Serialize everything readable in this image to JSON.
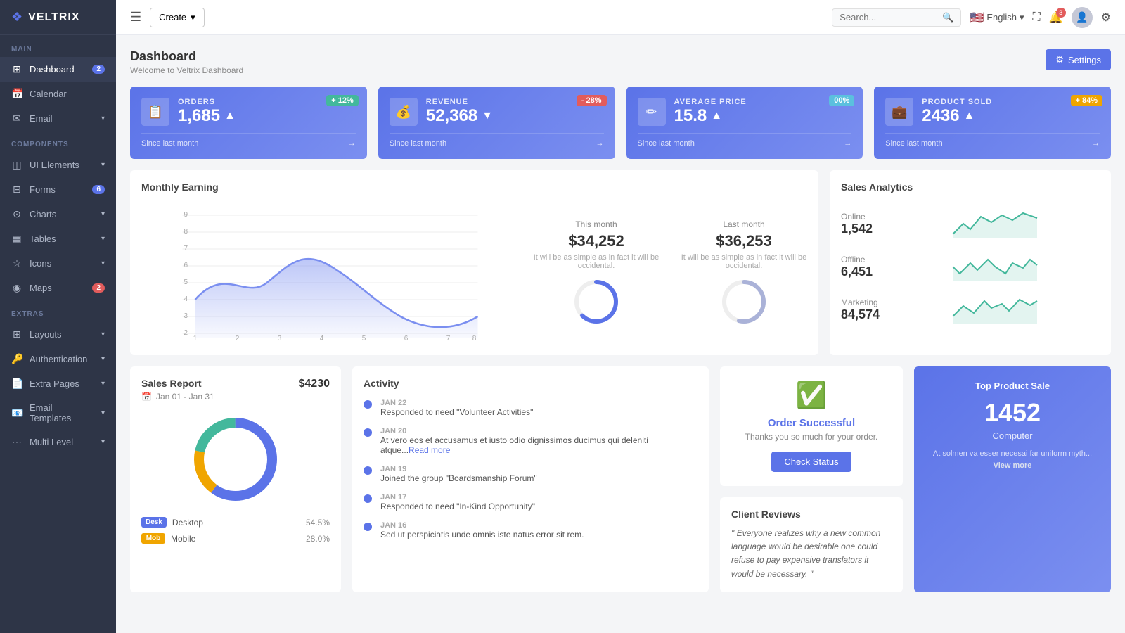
{
  "sidebar": {
    "logo": "VELTRIX",
    "sections": [
      {
        "label": "MAIN",
        "items": [
          {
            "id": "dashboard",
            "label": "Dashboard",
            "icon": "⊞",
            "badge": "2",
            "badgeColor": "blue",
            "active": true
          },
          {
            "id": "calendar",
            "label": "Calendar",
            "icon": "📅",
            "badge": "",
            "arrow": true
          },
          {
            "id": "email",
            "label": "Email",
            "icon": "✉",
            "badge": "",
            "arrow": true
          }
        ]
      },
      {
        "label": "COMPONENTS",
        "items": [
          {
            "id": "ui-elements",
            "label": "UI Elements",
            "icon": "◫",
            "badge": "",
            "arrow": true
          },
          {
            "id": "forms",
            "label": "Forms",
            "icon": "⊟",
            "badge": "6",
            "badgeColor": "green",
            "arrow": true
          },
          {
            "id": "charts",
            "label": "Charts",
            "icon": "⊙",
            "badge": "",
            "arrow": true
          },
          {
            "id": "tables",
            "label": "Tables",
            "icon": "▦",
            "badge": "",
            "arrow": true
          },
          {
            "id": "icons",
            "label": "Icons",
            "icon": "☆",
            "badge": "",
            "arrow": true
          },
          {
            "id": "maps",
            "label": "Maps",
            "icon": "◉",
            "badge": "2",
            "badgeColor": "red",
            "arrow": true
          }
        ]
      },
      {
        "label": "EXTRAS",
        "items": [
          {
            "id": "layouts",
            "label": "Layouts",
            "icon": "⊞",
            "badge": "",
            "arrow": true
          },
          {
            "id": "authentication",
            "label": "Authentication",
            "icon": "🔑",
            "badge": "",
            "arrow": true
          },
          {
            "id": "extra-pages",
            "label": "Extra Pages",
            "icon": "📄",
            "badge": "",
            "arrow": true
          },
          {
            "id": "email-templates",
            "label": "Email Templates",
            "icon": "📧",
            "badge": "",
            "arrow": true
          },
          {
            "id": "multi-level",
            "label": "Multi Level",
            "icon": "⋯",
            "badge": "",
            "arrow": true
          }
        ]
      }
    ]
  },
  "topbar": {
    "create_label": "Create",
    "search_placeholder": "Search...",
    "lang": "English",
    "notif_count": "3"
  },
  "page": {
    "title": "Dashboard",
    "subtitle": "Welcome to Veltrix Dashboard",
    "settings_label": "Settings"
  },
  "stats": [
    {
      "id": "orders",
      "label": "ORDERS",
      "value": "1,685",
      "badge": "+12%",
      "badge_color": "green",
      "trend": "▲",
      "since": "Since last month"
    },
    {
      "id": "revenue",
      "label": "REVENUE",
      "value": "52,368",
      "badge": "-28%",
      "badge_color": "red",
      "trend": "▼",
      "since": "Since last month"
    },
    {
      "id": "avg-price",
      "label": "AVERAGE PRICE",
      "value": "15.8",
      "badge": "00%",
      "badge_color": "blue",
      "trend": "▲",
      "since": "Since last month"
    },
    {
      "id": "product-sold",
      "label": "PRODUCT SOLD",
      "value": "2436",
      "badge": "+84%",
      "badge_color": "yellow",
      "trend": "▲",
      "since": "Since last month"
    }
  ],
  "monthly_earning": {
    "title": "Monthly Earning",
    "this_month_label": "This month",
    "last_month_label": "Last month",
    "this_month_value": "$34,252",
    "last_month_value": "$36,253",
    "desc": "It will be as simple as in fact it will be occidental."
  },
  "sales_analytics": {
    "title": "Sales Analytics",
    "items": [
      {
        "label": "Online",
        "value": "1,542"
      },
      {
        "label": "Offline",
        "value": "6,451"
      },
      {
        "label": "Marketing",
        "value": "84,574"
      }
    ]
  },
  "sales_report": {
    "title": "Sales Report",
    "date_range": "Jan 01 - Jan 31",
    "total": "$4230",
    "devices": [
      {
        "name": "Desktop",
        "pct": "54.5%",
        "badge": "Desk",
        "color": "#5b73e8"
      },
      {
        "name": "Mobile",
        "pct": "28.0%",
        "badge": "Mob",
        "color": "#f0a500"
      }
    ]
  },
  "activity": {
    "title": "Activity",
    "items": [
      {
        "date": "JAN 22",
        "text": "Responded to need \"Volunteer Activities\""
      },
      {
        "date": "JAN 20",
        "text": "At vero eos et accusamus et iusto odio dignissimos ducimus qui deleniti atque...",
        "read_more": "Read more"
      },
      {
        "date": "JAN 19",
        "text": "Joined the group \"Boardsmanship Forum\""
      },
      {
        "date": "JAN 17",
        "text": "Responded to need \"In-Kind Opportunity\""
      },
      {
        "date": "JAN 16",
        "text": "Sed ut perspiciatis unde omnis iste natus error sit rem."
      }
    ]
  },
  "order_success": {
    "title": "Order Successful",
    "desc": "Thanks you so much for your order.",
    "btn_label": "Check Status"
  },
  "top_product": {
    "label": "Top Product Sale",
    "value": "1452",
    "name": "Computer",
    "desc": "At solmen va esser necesai far uniform myth...",
    "view_more": "View more"
  },
  "client_reviews": {
    "title": "Client Reviews",
    "text": "\" Everyone realizes why a new common language would be desirable one could refuse to pay expensive translators it would be necessary. \""
  }
}
